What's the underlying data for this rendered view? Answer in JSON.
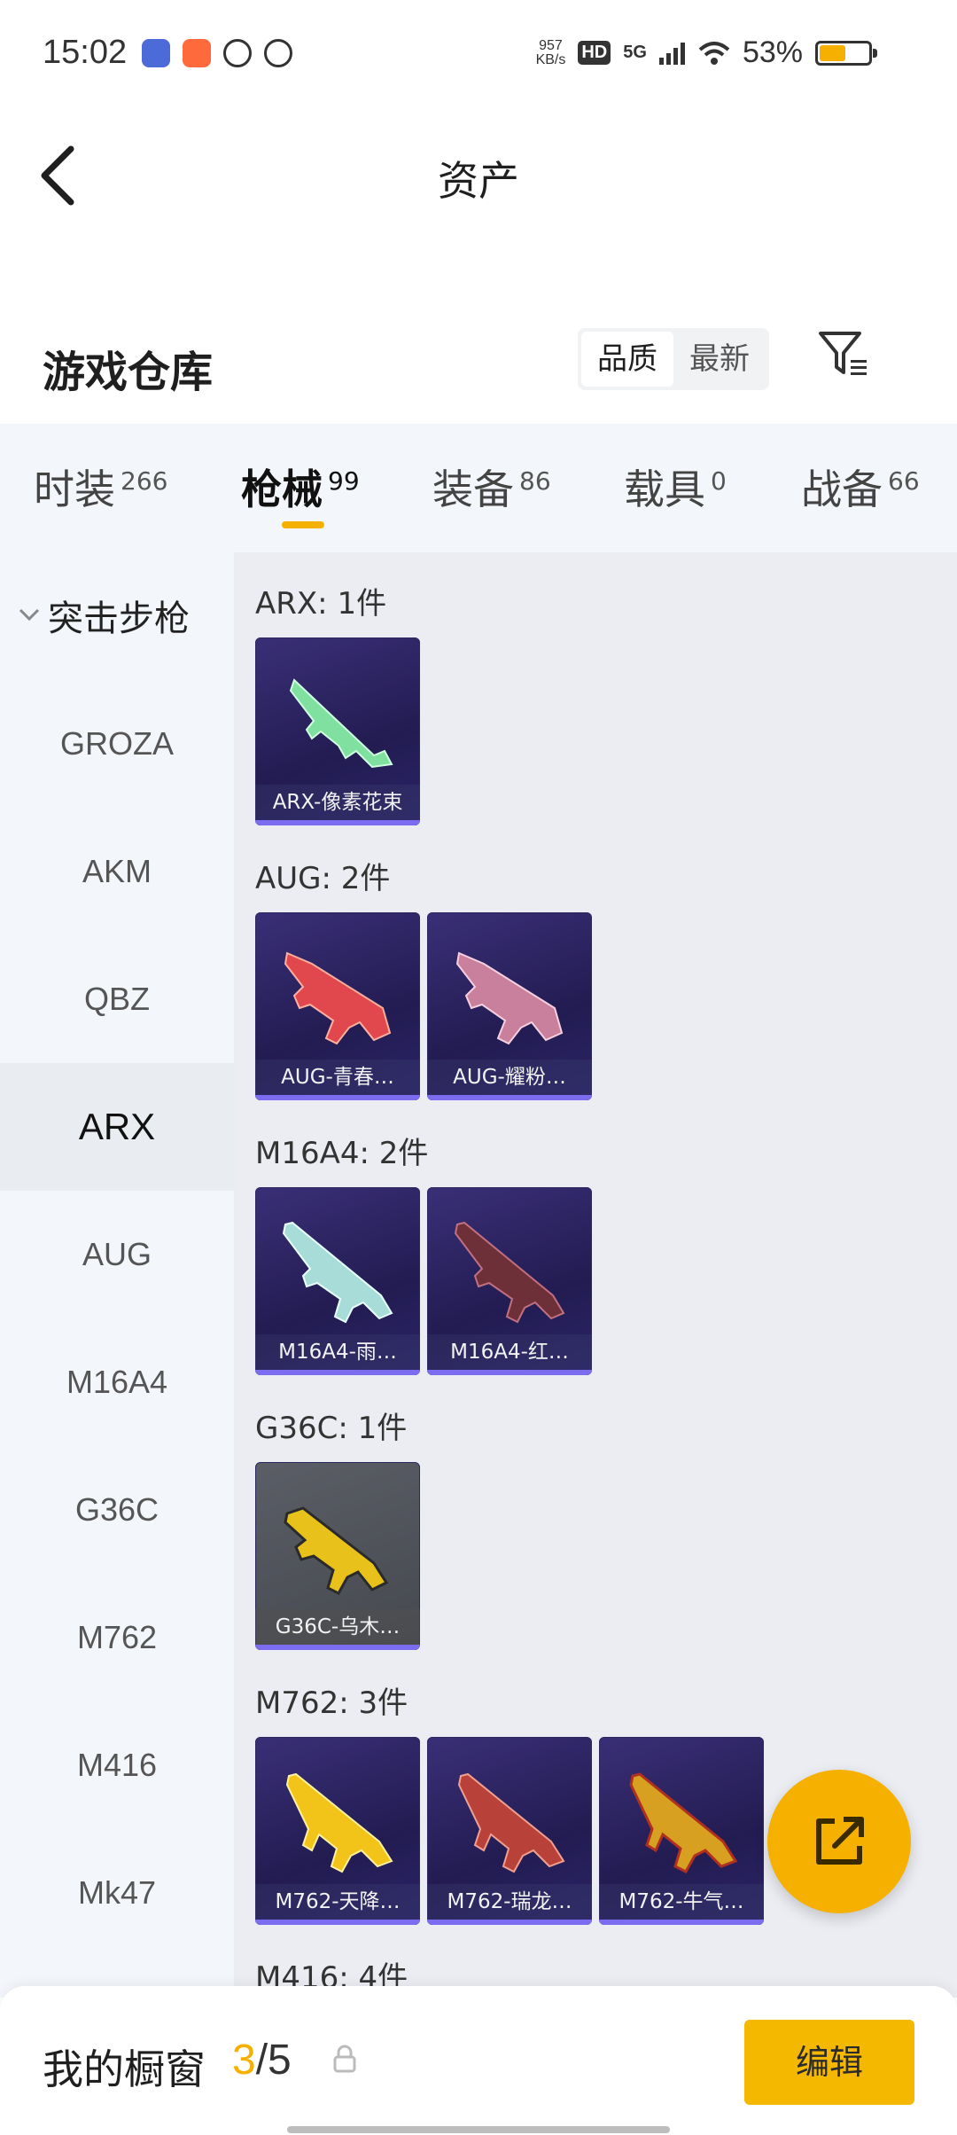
{
  "status_bar": {
    "time": "15:02",
    "net_speed_value": "957",
    "net_speed_unit": "KB/s",
    "hd": "HD",
    "network": "5G",
    "battery": "53%",
    "battery_level": 0.53,
    "accent": "#f5b000"
  },
  "top_bar": {
    "title": "资产"
  },
  "warehouse": {
    "title": "游戏仓库",
    "sort_options": [
      "品质",
      "最新"
    ],
    "selected_sort": "品质"
  },
  "tabs": [
    {
      "label": "时装",
      "count": "266"
    },
    {
      "label": "枪械",
      "count": "99",
      "active": true
    },
    {
      "label": "装备",
      "count": "86"
    },
    {
      "label": "载具",
      "count": "0"
    },
    {
      "label": "战备",
      "count": "66"
    }
  ],
  "sidebar": {
    "group": "突击步枪",
    "items": [
      "GROZA",
      "AKM",
      "QBZ",
      "ARX",
      "AUG",
      "M16A4",
      "G36C",
      "M762",
      "M416",
      "Mk47"
    ],
    "active": "ARX"
  },
  "groups": [
    {
      "label": "ARX: 1件",
      "items": [
        {
          "name": "ARX-像素花束",
          "icon": "green-rifle-icon"
        }
      ]
    },
    {
      "label": "AUG: 2件",
      "items": [
        {
          "name": "AUG-青春…",
          "icon": "red-bullpup-icon"
        },
        {
          "name": "AUG-耀粉…",
          "icon": "pink-bullpup-icon"
        }
      ]
    },
    {
      "label": "M16A4: 2件",
      "items": [
        {
          "name": "M16A4-雨…",
          "icon": "mint-rifle-icon"
        },
        {
          "name": "M16A4-红…",
          "icon": "dark-red-rifle-icon"
        }
      ]
    },
    {
      "label": "G36C: 1件",
      "items": [
        {
          "name": "G36C-乌木…",
          "icon": "gold-black-rifle-icon",
          "gray": true
        }
      ]
    },
    {
      "label": "M762: 3件",
      "items": [
        {
          "name": "M762-天降…",
          "icon": "gold-ak-icon"
        },
        {
          "name": "M762-瑞龙…",
          "icon": "red-ak-icon"
        },
        {
          "name": "M762-牛气…",
          "icon": "gold-red-ak-icon"
        }
      ]
    },
    {
      "label": "M416: 4件",
      "items": []
    }
  ],
  "bottom": {
    "showcase_label": "我的橱窗",
    "current": "3",
    "sep": "/",
    "total": "5",
    "edit_label": "编辑"
  }
}
